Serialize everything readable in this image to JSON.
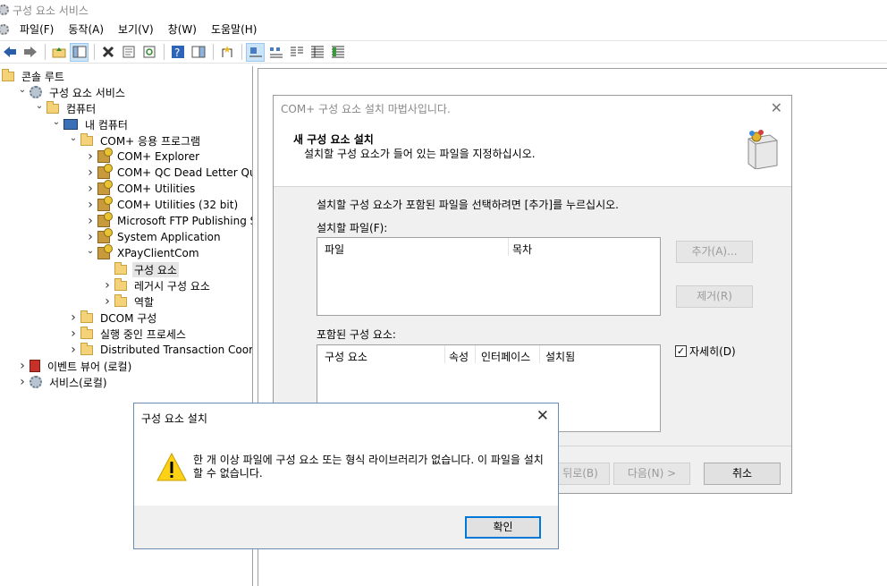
{
  "window": {
    "title": "구성 요소 서비스"
  },
  "menu": [
    "파일(F)",
    "동작(A)",
    "보기(V)",
    "창(W)",
    "도움말(H)"
  ],
  "tree": [
    {
      "label": "콘솔 루트",
      "icon": "folder-icon",
      "chev": "",
      "indent": 0
    },
    {
      "label": "구성 요소 서비스",
      "icon": "gear-icon",
      "chev": "v",
      "indent": 1
    },
    {
      "label": "컴퓨터",
      "icon": "folder-icon",
      "chev": "v",
      "indent": 2
    },
    {
      "label": "내 컴퓨터",
      "icon": "computer-icon",
      "chev": "v",
      "indent": 3
    },
    {
      "label": "COM+ 응용 프로그램",
      "icon": "folder-icon",
      "chev": "v",
      "indent": 4
    },
    {
      "label": "COM+ Explorer",
      "icon": "package-icon",
      "chev": ">",
      "indent": 5
    },
    {
      "label": "COM+ QC Dead Letter Queue",
      "icon": "package-icon",
      "chev": ">",
      "indent": 5
    },
    {
      "label": "COM+ Utilities",
      "icon": "package-icon",
      "chev": ">",
      "indent": 5
    },
    {
      "label": "COM+ Utilities (32 bit)",
      "icon": "package-icon",
      "chev": ">",
      "indent": 5
    },
    {
      "label": "Microsoft FTP Publishing Servic",
      "icon": "package-icon",
      "chev": ">",
      "indent": 5
    },
    {
      "label": "System Application",
      "icon": "package-icon",
      "chev": ">",
      "indent": 5
    },
    {
      "label": "XPayClientCom",
      "icon": "package-icon",
      "chev": "v",
      "indent": 5
    },
    {
      "label": "구성 요소",
      "icon": "folder-icon",
      "chev": "",
      "indent": 6,
      "selected": true
    },
    {
      "label": "레거시 구성 요소",
      "icon": "folder-icon",
      "chev": ">",
      "indent": 6
    },
    {
      "label": "역할",
      "icon": "folder-icon",
      "chev": ">",
      "indent": 6
    },
    {
      "label": "DCOM 구성",
      "icon": "folder-icon",
      "chev": ">",
      "indent": 4
    },
    {
      "label": "실행 중인 프로세스",
      "icon": "folder-icon",
      "chev": ">",
      "indent": 4
    },
    {
      "label": "Distributed Transaction Coordinato",
      "icon": "folder-icon",
      "chev": ">",
      "indent": 4
    },
    {
      "label": "이벤트 뷰어 (로컬)",
      "icon": "event-viewer-icon",
      "chev": ">",
      "indent": 1
    },
    {
      "label": "서비스(로컬)",
      "icon": "gear-icon",
      "chev": ">",
      "indent": 1
    }
  ],
  "wizard": {
    "title": "COM+ 구성 요소 설치 마법사입니다.",
    "heading": "새 구성 요소 설치",
    "subheading": "설치할 구성 요소가 들어 있는 파일을 지정하십시오.",
    "instruction": "설치할 구성 요소가 포함된 파일을 선택하려면 [추가]를 누르십시오.",
    "files_label": "설치할 파일(F):",
    "files_cols": [
      "파일",
      "목차"
    ],
    "add_btn": "추가(A)...",
    "remove_btn": "제거(R)",
    "components_label": "포함된 구성 요소:",
    "components_cols": [
      "구성 요소",
      "속성",
      "인터페이스",
      "설치됨"
    ],
    "details_chk": "자세히(D)",
    "details_checked": true,
    "back_btn": "뒤로(B)",
    "next_btn": "다음(N) >",
    "cancel_btn": "취소"
  },
  "message": {
    "title": "구성 요소 설치",
    "text": "한 개 이상 파일에 구성 요소 또는 형식 라이브러리가 없습니다. 이 파일을 설치할 수 없습니다.",
    "ok_btn": "확인"
  }
}
